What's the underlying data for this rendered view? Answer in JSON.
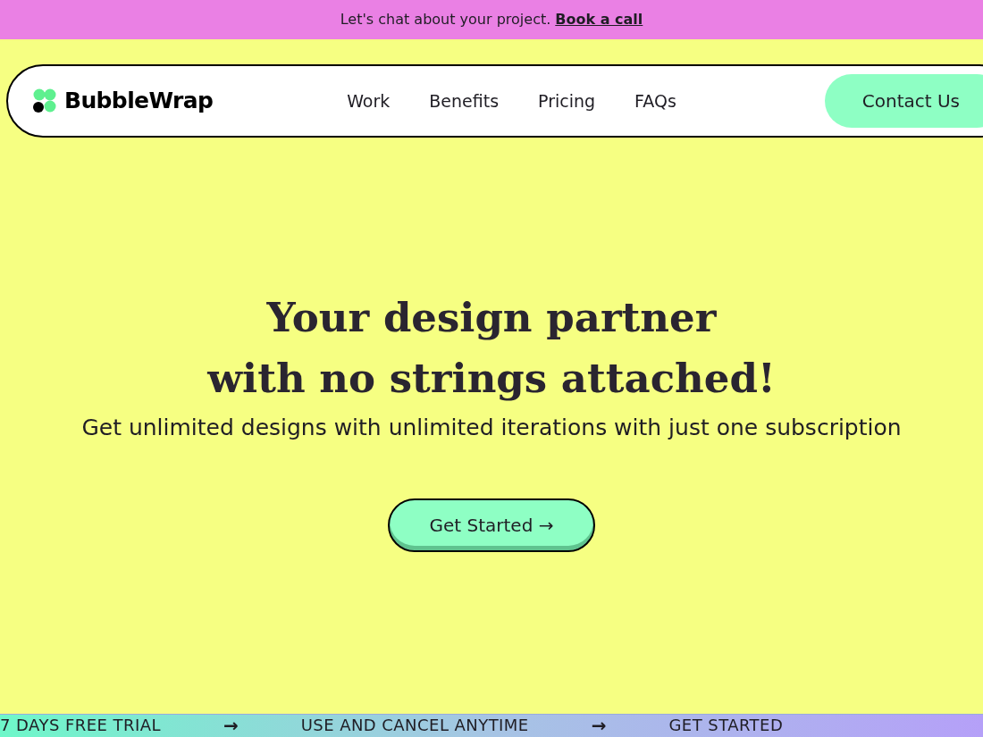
{
  "announcement": {
    "text": "Let's chat about your project.",
    "link": "Book a call"
  },
  "nav": {
    "brand": "BubbleWrap",
    "links": [
      "Work",
      "Benefits",
      "Pricing",
      "FAQs"
    ],
    "cta": "Contact Us"
  },
  "hero": {
    "title_lines": [
      "Your design partner",
      "with no strings attached!"
    ],
    "subtitle": "Get unlimited designs with unlimited iterations with just one subscription",
    "button": "Get Started →"
  },
  "marquee": [
    {
      "kind": "text",
      "text": "7 DAYS FREE TRIAL"
    },
    {
      "kind": "arrow",
      "text": "→"
    },
    {
      "kind": "text",
      "text": "USE AND CANCEL ANYTIME"
    },
    {
      "kind": "arrow",
      "text": "→"
    },
    {
      "kind": "text",
      "text": "GET STARTED"
    }
  ]
}
